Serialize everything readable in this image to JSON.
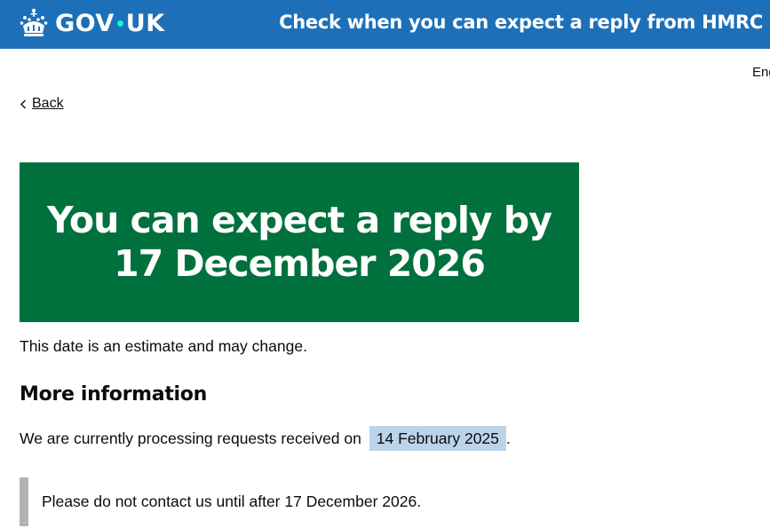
{
  "header": {
    "logo_text_left": "GOV",
    "logo_text_right": "UK",
    "service_name": "Check when you can expect a reply from HMRC",
    "crown_icon": "crown-icon"
  },
  "language": {
    "label": "Eng"
  },
  "back": {
    "label": "Back",
    "icon": "chevron-left-icon"
  },
  "panel": {
    "line1": "You can expect a reply by",
    "line2": "17 December 2026",
    "background": "#00703c"
  },
  "estimate_text": "This date is an estimate and may change.",
  "more_info": {
    "heading": "More information",
    "processing_text": "We are currently processing requests received on",
    "processing_date": "14 February 2025",
    "processing_suffix": "."
  },
  "inset": {
    "text": "Please do not contact us until after 17 December 2026."
  },
  "colors": {
    "header": "#1d70b8",
    "highlight": "#bbd4ea",
    "inset_border": "#b1b4b6"
  }
}
